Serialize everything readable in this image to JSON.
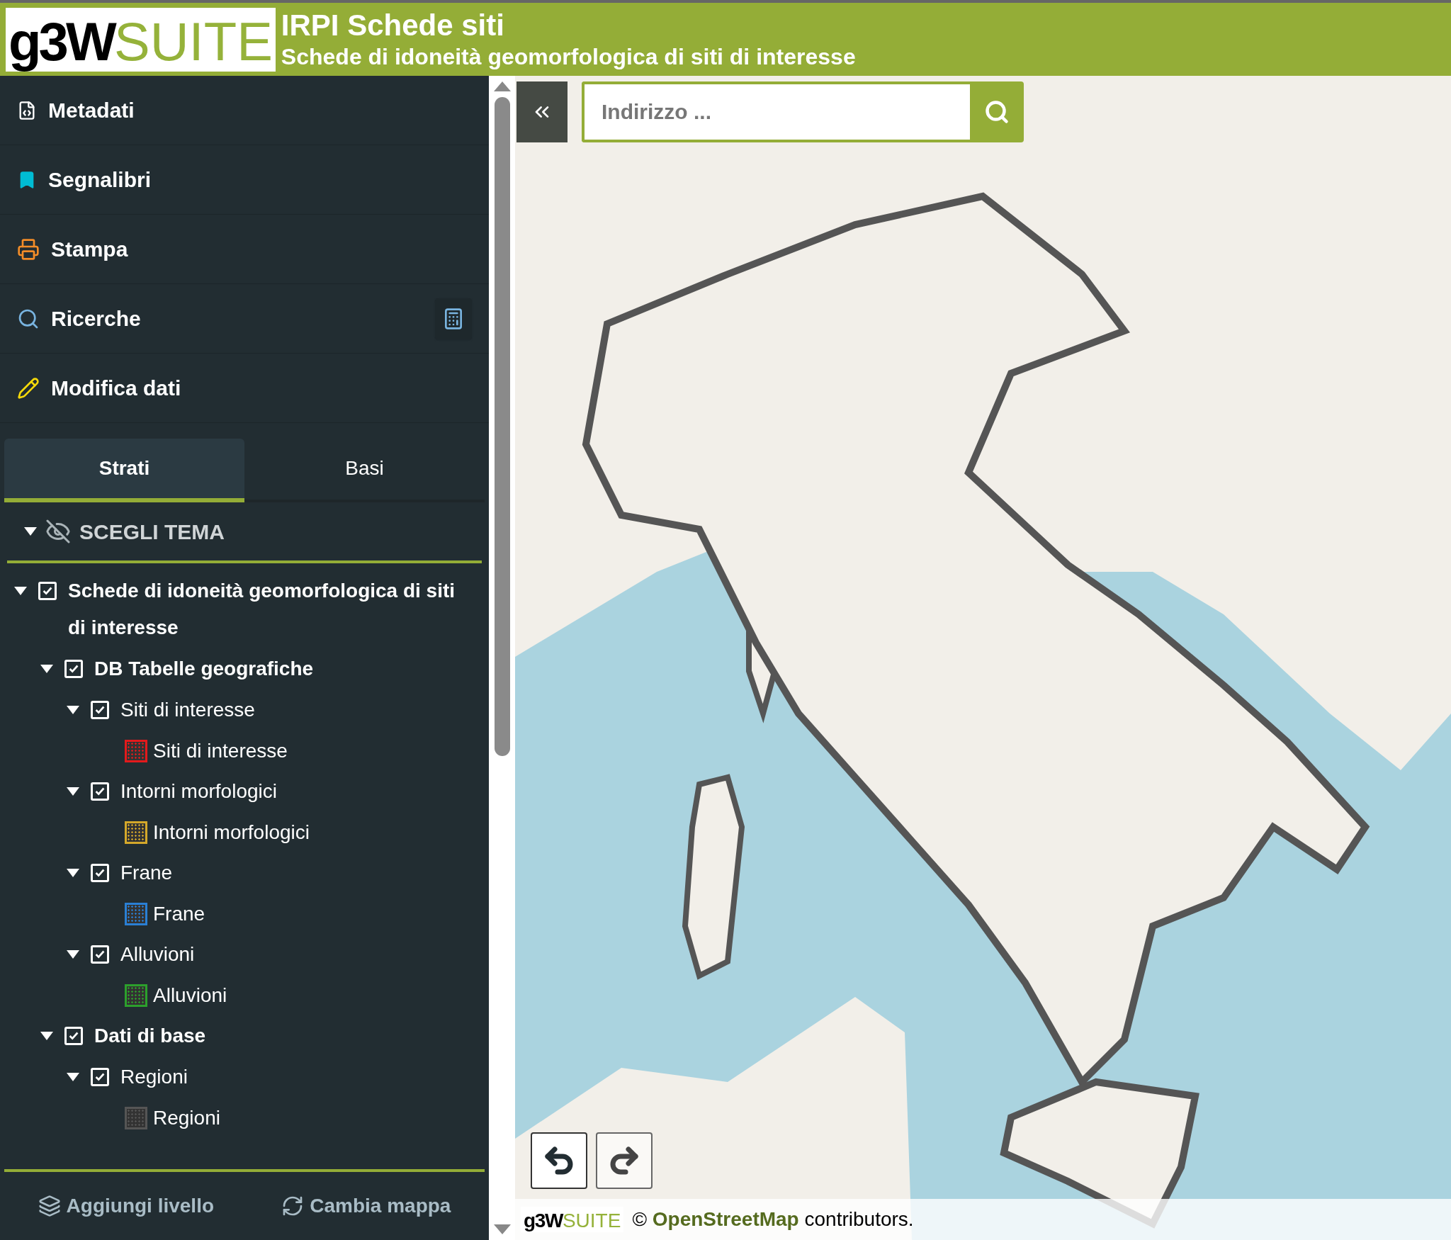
{
  "header": {
    "logo": {
      "part_1": "g3W",
      "part_2": "SUITE"
    },
    "title": "IRPI Schede siti",
    "subtitle": "Schede di idoneità geomorfologica di siti di interesse"
  },
  "menu": [
    {
      "kind": "metadata",
      "label": "Metadati"
    },
    {
      "kind": "bookmark",
      "label": "Segnalibri"
    },
    {
      "kind": "print",
      "label": "Stampa"
    },
    {
      "kind": "search",
      "label": "Ricerche",
      "calculator": true
    },
    {
      "kind": "edit",
      "label": "Modifica dati"
    }
  ],
  "tabs": [
    {
      "label": "Strati",
      "selected": true
    },
    {
      "label": "Basi",
      "selected": false
    }
  ],
  "theme": {
    "label": "SCEGLI TEMA",
    "expanded": true
  },
  "tree": [
    {
      "kind": "group",
      "label": "Schede di idoneità geomorfologica di siti di interesse",
      "checked": true,
      "expanded": true,
      "children": [
        {
          "kind": "group",
          "label": "DB Tabelle geografiche",
          "checked": true,
          "expanded": true,
          "children": [
            {
              "kind": "layer",
              "label": "Siti di interesse",
              "checked": true,
              "expanded": true,
              "children": [
                {
                  "kind": "legend",
                  "label": "Siti di interesse",
                  "color": "#e31a1c"
                }
              ]
            },
            {
              "kind": "layer",
              "label": "Intorni morfologici",
              "checked": true,
              "expanded": true,
              "children": [
                {
                  "kind": "legend",
                  "label": "Intorni morfologici",
                  "color": "#d4a82a"
                }
              ]
            },
            {
              "kind": "layer",
              "label": "Frane",
              "checked": true,
              "expanded": true,
              "children": [
                {
                  "kind": "legend",
                  "label": "Frane",
                  "color": "#2a7fd4"
                }
              ]
            },
            {
              "kind": "layer",
              "label": "Alluvioni",
              "checked": true,
              "expanded": true,
              "children": [
                {
                  "kind": "legend",
                  "label": "Alluvioni",
                  "color": "#2ca02c"
                }
              ]
            }
          ]
        },
        {
          "kind": "group",
          "label": "Dati di base",
          "checked": true,
          "expanded": true,
          "children": [
            {
              "kind": "layer",
              "label": "Regioni",
              "checked": true,
              "expanded": true,
              "children": [
                {
                  "kind": "legend",
                  "label": "Regioni",
                  "color": "#555555"
                }
              ]
            }
          ]
        }
      ]
    }
  ],
  "footer_buttons": [
    {
      "kind": "layers",
      "label": "Aggiungi livello"
    },
    {
      "kind": "refresh",
      "label": "Cambia mappa"
    }
  ],
  "map": {
    "search": {
      "placeholder": "Indirizzo ..."
    },
    "attribution": {
      "logo": {
        "part_1": "g3W",
        "part_2": "SUITE"
      },
      "symbol": "©",
      "link": "OpenStreetMap",
      "text": "contributors."
    }
  }
}
